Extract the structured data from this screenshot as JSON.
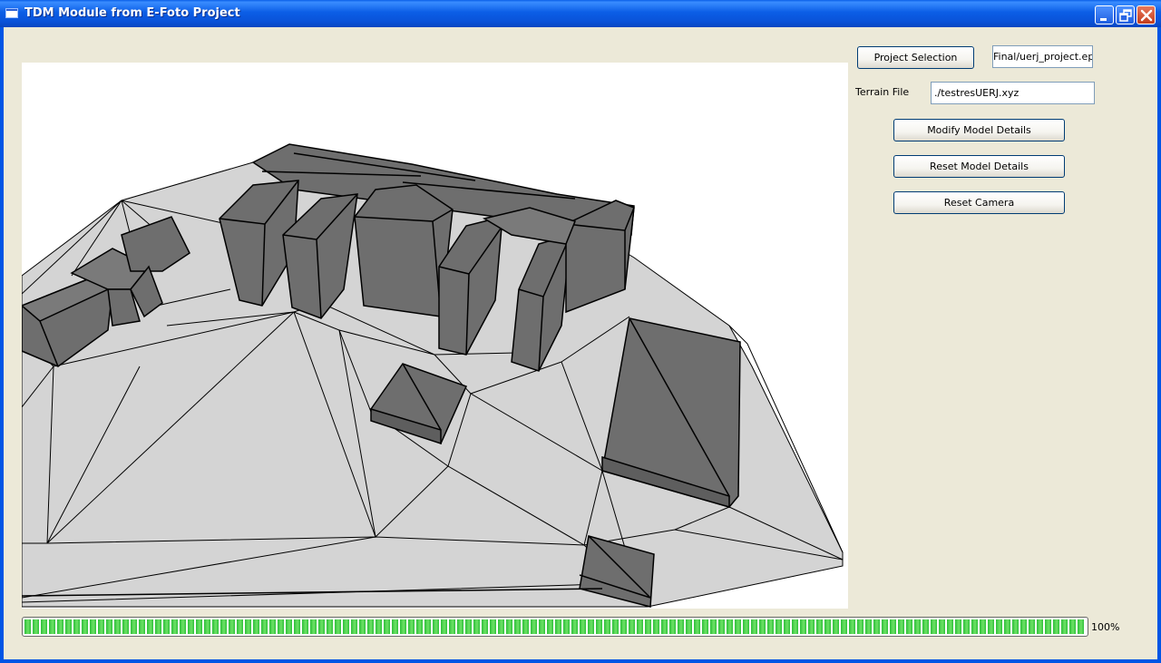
{
  "window": {
    "title": "TDM Module from E-Foto Project"
  },
  "panel": {
    "project_button": "Project Selection",
    "project_path": "Final/uerj_project.epp",
    "terrain_label": "Terrain File",
    "terrain_path": "./testresUERJ.xyz",
    "modify_button": "Modify Model Details",
    "reset_model_button": "Reset Model Details",
    "reset_camera_button": "Reset Camera"
  },
  "progress": {
    "value": 100,
    "label": "100%"
  },
  "colors": {
    "terrain": "#d4d4d4",
    "building": "#6e6e6e",
    "progress": "#2ebf3a"
  },
  "icons": [
    "app-icon",
    "minimize-icon",
    "restore-icon",
    "close-icon"
  ]
}
